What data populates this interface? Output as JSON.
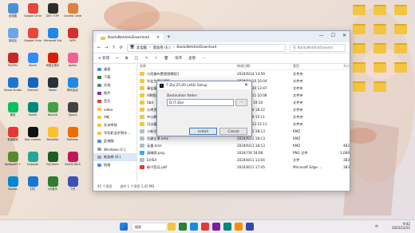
{
  "desktop": {
    "icons": [
      {
        "label": "此电脑"
      },
      {
        "label": "Google Chrome"
      },
      {
        "label": "DEV TOP!"
      },
      {
        "label": "Control Center"
      },
      {
        "label": "回收站"
      },
      {
        "label": "Google Chrome"
      },
      {
        "label": "Microsoft Edge"
      },
      {
        "label": "WPS"
      },
      {
        "label": "FileZilla"
      },
      {
        "label": "Zoom"
      },
      {
        "label": "网易云音乐"
      },
      {
        "label": "Apifox"
      },
      {
        "label": "Visual Studio Code"
      },
      {
        "label": "Foxmail"
      },
      {
        "label": "Steam"
      },
      {
        "label": "腾讯会议"
      },
      {
        "label": "微信"
      },
      {
        "label": "Xshell"
      },
      {
        "label": "Navicat"
      },
      {
        "label": "Typora"
      },
      {
        "label": "有道翻译"
      },
      {
        "label": "Epic Games"
      },
      {
        "label": "BandiZip"
      },
      {
        "label": "Postman"
      },
      {
        "label": "Notepad++"
      },
      {
        "label": "Snipaste"
      },
      {
        "label": "PyCharm"
      },
      {
        "label": "IntelliJ IDEA"
      },
      {
        "label": "Docker"
      },
      {
        "label": "钉钉"
      },
      {
        "label": "QQ音乐"
      },
      {
        "label": "飞书"
      }
    ],
    "right_folders": [
      "",
      "",
      "",
      "",
      "",
      "",
      "",
      "",
      "",
      "",
      "",
      "",
      "",
      ""
    ]
  },
  "explorer": {
    "tab_title": "BaiduNetdiskDownload",
    "window_buttons": {
      "minimize": "—",
      "maximize": "☐",
      "close": "✕"
    },
    "nav": {
      "back": "←",
      "forward": "→",
      "up": "↑",
      "refresh": "⟳"
    },
    "address": [
      "此电脑",
      "新加卷 (E:)",
      "BaiduNetdiskDownload"
    ],
    "search_placeholder": "在 BaiduNetdiskDownlo",
    "commands": {
      "new": "新建",
      "cut": "✂",
      "copy": "⧉",
      "paste": "📋",
      "rename": "✎",
      "share": "⇪",
      "delete": "🗑",
      "sort": "排序",
      "view": "查看",
      "more": "···"
    },
    "sidebar": [
      {
        "label": "桌面"
      },
      {
        "label": "下载"
      },
      {
        "label": "文档"
      },
      {
        "label": "图片"
      },
      {
        "label": "音乐"
      },
      {
        "label": "video"
      },
      {
        "label": "3笔"
      },
      {
        "label": "实训考核"
      },
      {
        "label": "华北职业学院毕..."
      },
      {
        "label": "此电脑"
      },
      {
        "label": "Windows (C:)"
      },
      {
        "label": "新加卷 (E:)"
      },
      {
        "label": "网络"
      }
    ],
    "columns": {
      "name": "名称",
      "date": "修改日期",
      "type": "类型",
      "size": "大小"
    },
    "files": [
      {
        "name": "小而美布置视频教程1",
        "date": "2024/6/14 13:59",
        "type": "文件夹",
        "size": "",
        "kind": "folder"
      },
      {
        "name": "毕业生简历模板",
        "date": "2024/11/10 16:04",
        "type": "文件夹",
        "size": "",
        "kind": "folder"
      },
      {
        "name": "事业编考试",
        "date": "2024/11/30 13:47",
        "type": "文件夹",
        "size": "",
        "kind": "folder"
      },
      {
        "name": "4寒假视频",
        "date": "2024/10/11 10:08",
        "type": "文件夹",
        "size": "",
        "kind": "folder"
      },
      {
        "name": "5bd",
        "date": "2025/9/6 19:10",
        "type": "文件夹",
        "size": "",
        "kind": "folder"
      },
      {
        "name": "公考资料",
        "date": "2025/12/4 18:22",
        "type": "文件夹",
        "size": "",
        "kind": "folder"
      },
      {
        "name": "中公教师",
        "date": "2025/12/9 15:11",
        "type": "文件夹",
        "size": "",
        "kind": "folder"
      },
      {
        "name": "可以看学习资料",
        "date": "2025/12/13 15:11",
        "type": "文件夹",
        "size": "",
        "kind": "folder"
      },
      {
        "name": "小新文件.kmz",
        "date": "2024/6/11 18:13",
        "type": "KMZ",
        "size": "",
        "kind": "file"
      },
      {
        "name": "西藏全景.kmz",
        "date": "2024/6/11 18:13",
        "type": "KMZ",
        "size": "",
        "kind": "file"
      },
      {
        "name": "无量.kmz",
        "date": "2024/6/11 18:13",
        "type": "KMZ",
        "size": "482",
        "kind": "file"
      },
      {
        "name": "清晰图.png",
        "date": "2024/7/8 18:08",
        "type": "PNG 文件",
        "size": "1,066",
        "kind": "image"
      },
      {
        "name": "EVISA",
        "date": "2024/8/11 13:04",
        "type": "文件",
        "size": "383",
        "kind": "file"
      },
      {
        "name": "新兴签证.pdf",
        "date": "2024/8/11 17:45",
        "type": "Microsoft Edge ...",
        "size": "383",
        "kind": "pdf"
      }
    ],
    "status": {
      "count": "45 个项目",
      "selected": "选中 1 个项目  1.45 MB"
    }
  },
  "dialog": {
    "title": "7-Zip 25.00 (x64) Setup",
    "label": "Destination folder:",
    "path": "D:\\7-Zip\\",
    "browse": "...",
    "install": "Install",
    "cancel": "Cancel",
    "close": "✕"
  },
  "taskbar": {
    "search": "搜索",
    "lang": "中",
    "time": "9:42",
    "date": "2025/12/21"
  }
}
